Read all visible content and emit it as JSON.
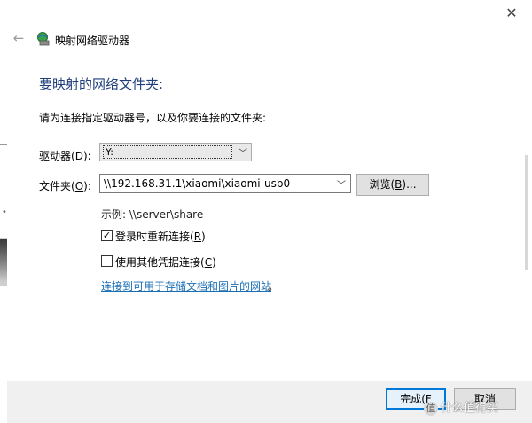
{
  "window": {
    "title": "映射网络驱动器",
    "close_glyph": "✕",
    "back_glyph": "←"
  },
  "heading": "要映射的网络文件夹:",
  "instruction": "请为连接指定驱动器号，以及你要连接的文件夹:",
  "drive": {
    "label_main": "驱动器(",
    "label_key": "D",
    "label_end": "):",
    "value": "Y:"
  },
  "folder": {
    "label_main": "文件夹(",
    "label_key": "O",
    "label_end": "):",
    "value": "\\\\192.168.31.1\\xiaomi\\xiaomi-usb0"
  },
  "browse_button": {
    "label_main": "浏览(",
    "label_key": "B",
    "label_end": ")..."
  },
  "example": "示例: \\\\server\\share",
  "reconnect": {
    "checked": true,
    "label_main": "登录时重新连接(",
    "label_key": "R",
    "label_end": ")"
  },
  "other_credentials": {
    "checked": false,
    "label_main": "使用其他凭据连接(",
    "label_key": "C",
    "label_end": ")"
  },
  "link_text": "连接到可用于存储文档和图片的网站",
  "link_period": "。",
  "finish_button": "完成(F",
  "cancel_button": "取消",
  "watermark": {
    "badge": "值",
    "text": "什么值得买"
  }
}
